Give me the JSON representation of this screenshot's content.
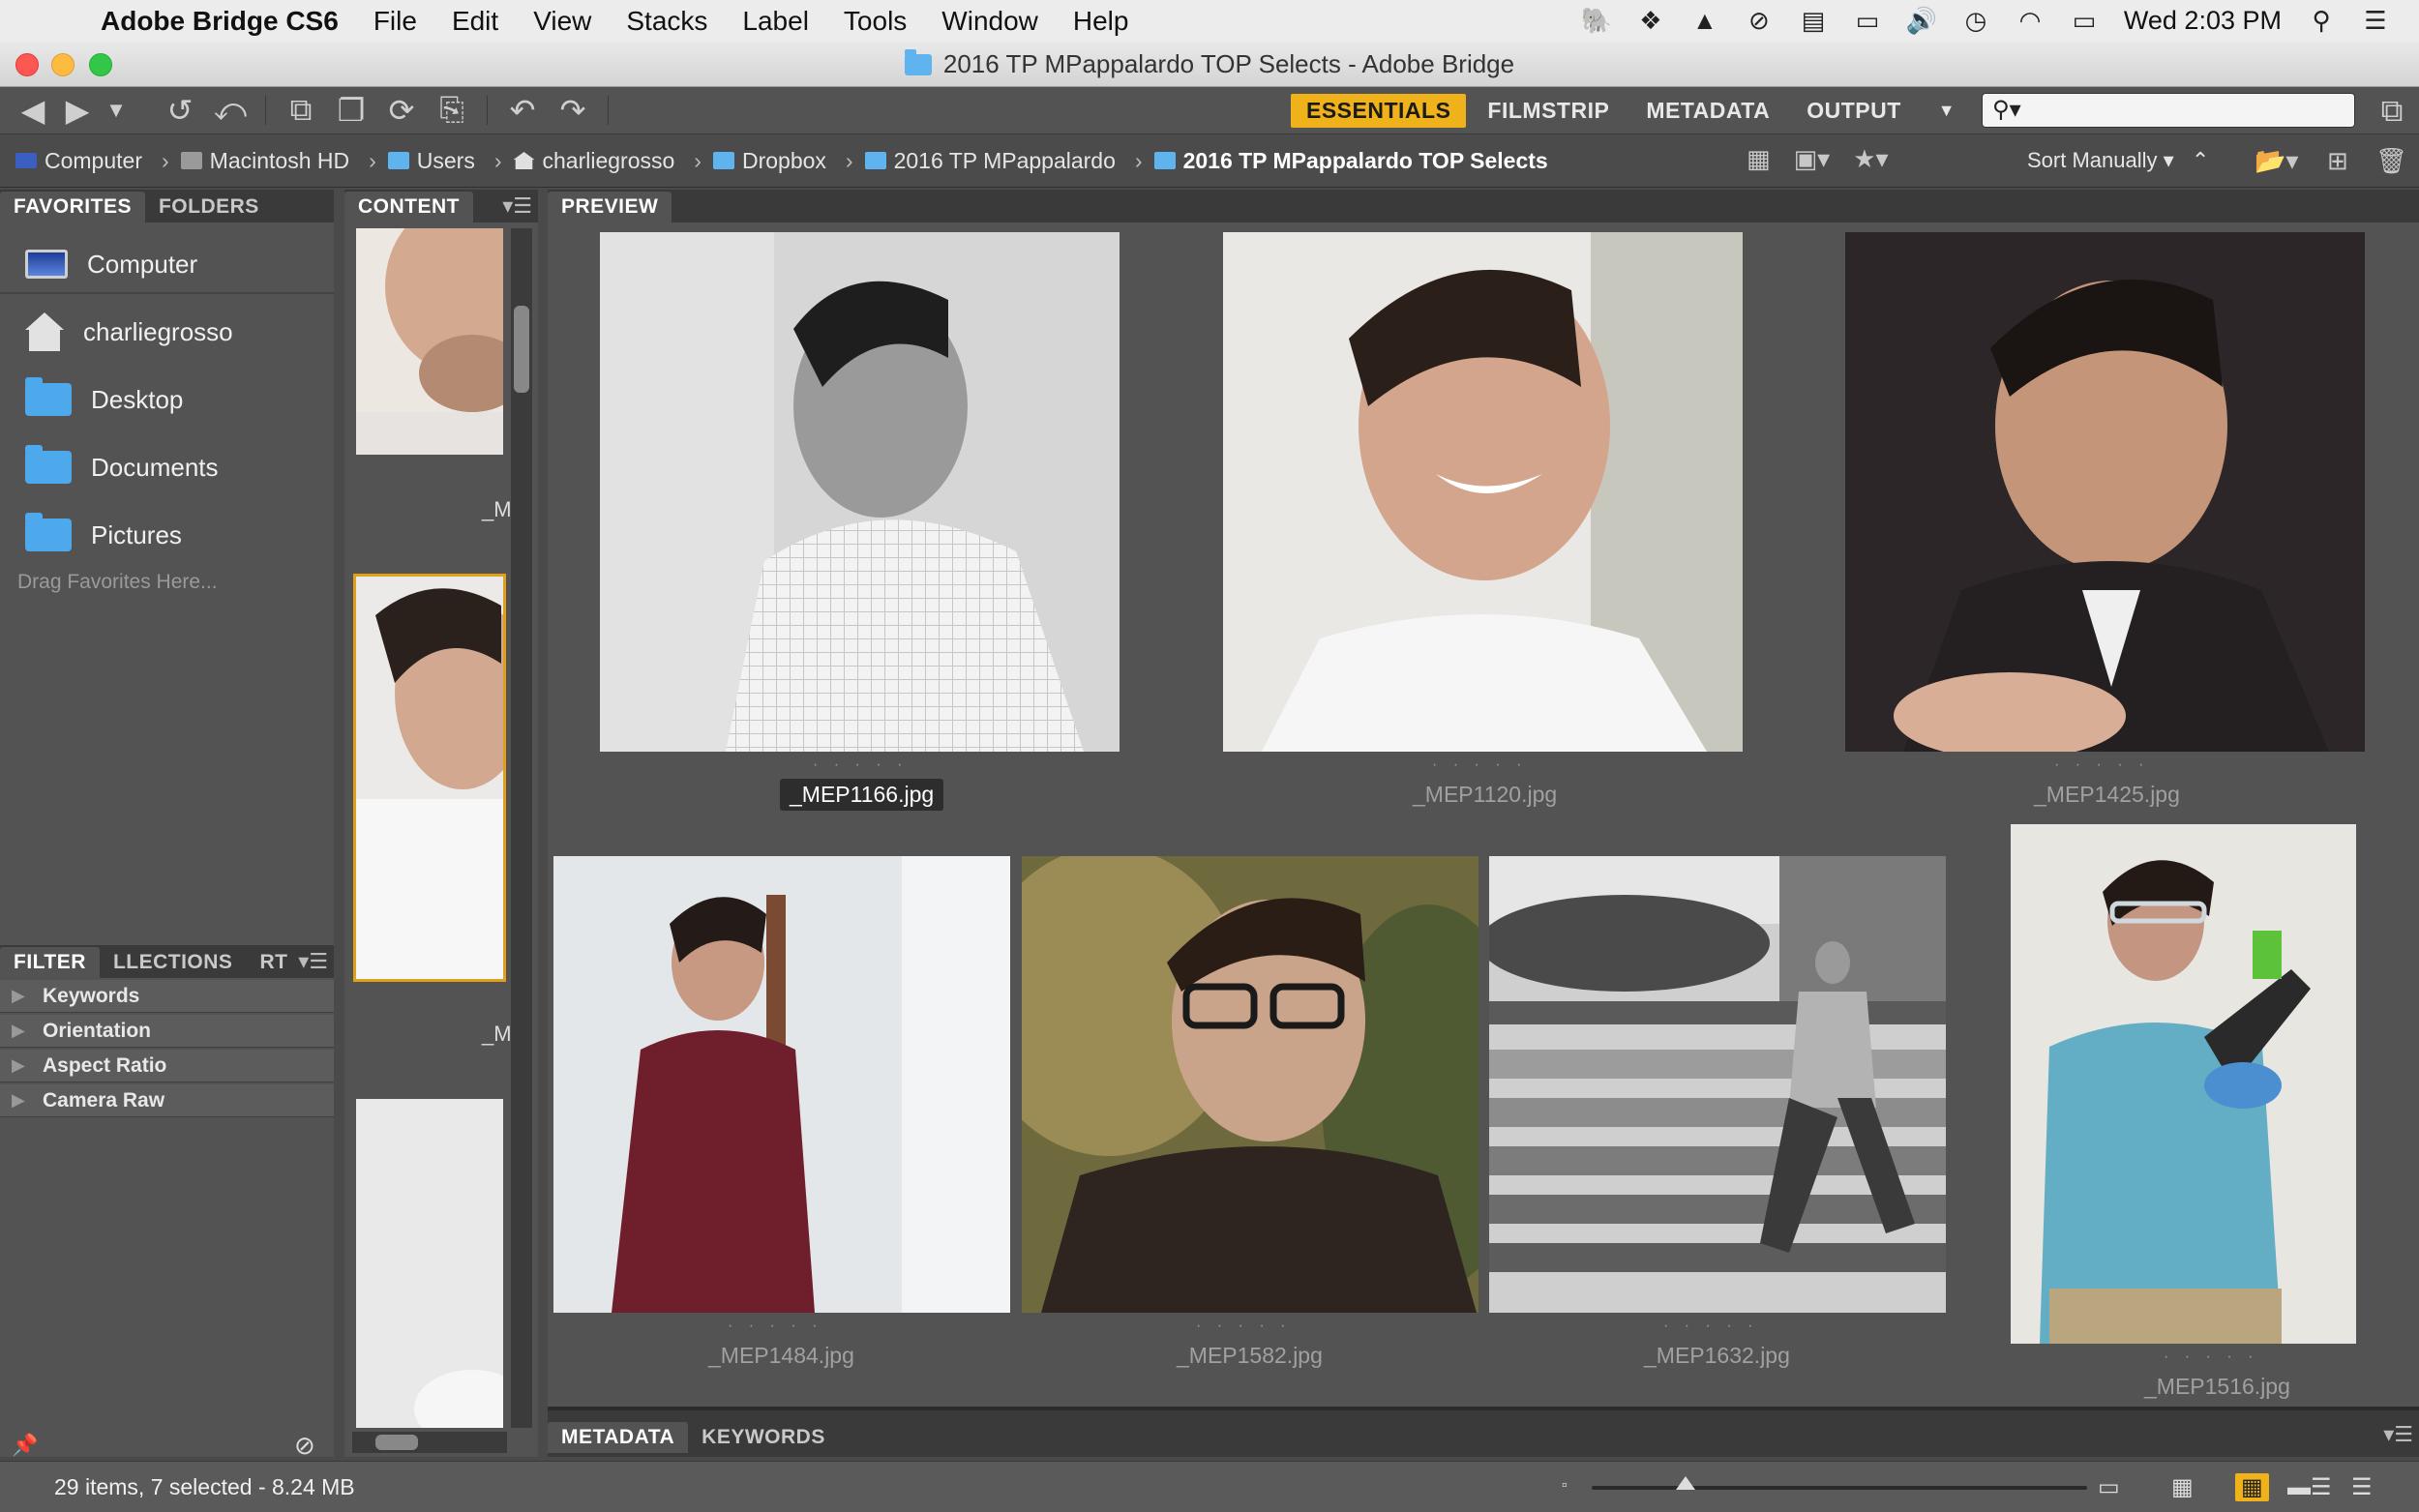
{
  "menubar": {
    "app_name": "Adobe Bridge CS6",
    "items": [
      "File",
      "Edit",
      "View",
      "Stacks",
      "Label",
      "Tools",
      "Window",
      "Help"
    ],
    "clock": "Wed 2:03 PM"
  },
  "window": {
    "title": "2016 TP MPappalardo TOP Selects - Adobe Bridge"
  },
  "toolbar": {
    "workspaces": [
      "ESSENTIALS",
      "FILMSTRIP",
      "METADATA",
      "OUTPUT"
    ],
    "active_workspace": "ESSENTIALS",
    "search": {
      "value": "",
      "placeholder": ""
    }
  },
  "path": {
    "crumbs": [
      "Computer",
      "Macintosh HD",
      "Users",
      "charliegrosso",
      "Dropbox",
      "2016 TP MPappalardo",
      "2016 TP MPappalardo TOP Selects"
    ],
    "sort_label": "Sort Manually"
  },
  "favorites": {
    "tabs": [
      "FAVORITES",
      "FOLDERS"
    ],
    "items": [
      "Computer",
      "charliegrosso",
      "Desktop",
      "Documents",
      "Pictures"
    ],
    "hint": "Drag Favorites Here..."
  },
  "filter": {
    "tabs": [
      "FILTER",
      "LLECTIONS",
      "RT"
    ],
    "rows": [
      "Keywords",
      "Orientation",
      "Aspect Ratio",
      "Camera Raw"
    ]
  },
  "content": {
    "tab": "CONTENT",
    "label_partial_1": "_M",
    "label_partial_2": "_M"
  },
  "preview": {
    "tab": "PREVIEW",
    "images": [
      {
        "file": "_MEP1166.jpg",
        "selected": true
      },
      {
        "file": "_MEP1120.jpg",
        "selected": false
      },
      {
        "file": "_MEP1425.jpg",
        "selected": false
      },
      {
        "file": "_MEP1484.jpg",
        "selected": false
      },
      {
        "file": "_MEP1582.jpg",
        "selected": false
      },
      {
        "file": "_MEP1632.jpg",
        "selected": false
      },
      {
        "file": "_MEP1516.jpg",
        "selected": false
      }
    ],
    "rating_dots": "· · · · ·"
  },
  "bottom_tabs": [
    "METADATA",
    "KEYWORDS"
  ],
  "status": {
    "text": "29 items, 7 selected - 8.24 MB",
    "thumbnail_size_fraction": 0.19
  },
  "colors": {
    "accent": "#f0b21b",
    "panel": "#535353",
    "folder_blue": "#5fb4ef"
  }
}
